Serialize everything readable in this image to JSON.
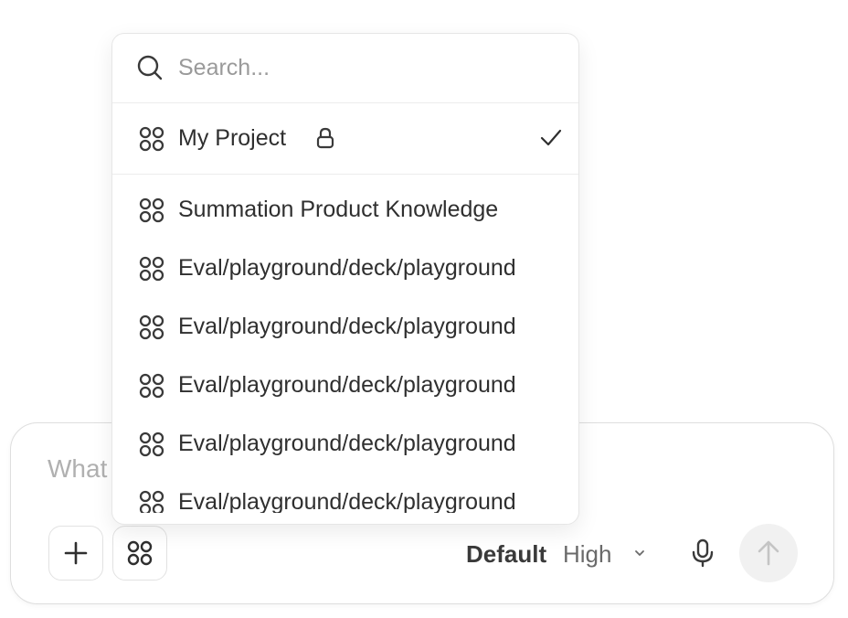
{
  "composer": {
    "placeholder_visible": "What",
    "model": "Default",
    "effort": "High"
  },
  "dropdown": {
    "search_placeholder": "Search...",
    "selected_project": "My Project",
    "projects": [
      "Summation Product Knowledge",
      "Eval/playground/deck/playground",
      "Eval/playground/deck/playground",
      "Eval/playground/deck/playground",
      "Eval/playground/deck/playground",
      "Eval/playground/deck/playground"
    ]
  },
  "icons": {
    "search": "search-icon",
    "project": "projects-icon",
    "lock": "lock-icon",
    "check": "check-icon",
    "plus": "plus-icon",
    "chevron": "chevron-down-icon",
    "mic": "microphone-icon",
    "send": "arrow-up-icon"
  },
  "colors": {
    "icon": "#3a3a3a",
    "muted": "#9a9a9a",
    "send_bg": "#f1f1f1",
    "send_arrow": "#c4c4c4"
  }
}
